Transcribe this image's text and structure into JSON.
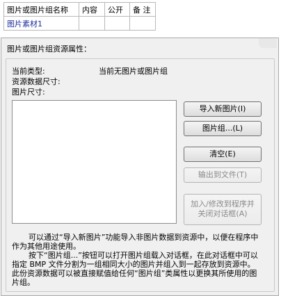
{
  "table": {
    "headers": [
      "图片或图片组名称",
      "内容",
      "公开",
      "备 注"
    ],
    "rows": [
      [
        "图片素材1",
        "",
        "",
        ""
      ]
    ]
  },
  "dialog": {
    "title": "图片或图片组资源属性：",
    "current_type_label": "当前类型:",
    "current_type_value": "当前无图片或图片组",
    "data_size_label": "资源数据尺寸:",
    "image_size_label": "图片尺寸:",
    "buttons": {
      "import": "导入新图片(I)",
      "group": "图片组...(L)",
      "clear": "清空(E)",
      "export": "输出到文件(T)",
      "add_line1": "加入/修改到程序并",
      "add_line2": "关闭对话框(A)"
    },
    "description": [
      "可以通过“导入新图片”功能导入非图片数据到资源中，以便在程序中作为其他用途使用。",
      "按下“图片组...”按钮可以打开图片组载入对话框，在此对话框中可以指定 BMP 文件分割为一组相同大小的图片并组入到一起存放到资源中。此份资源数据可以被直接赋值给任何“图片组”类属性以更换其所使用的图片组。"
    ]
  }
}
